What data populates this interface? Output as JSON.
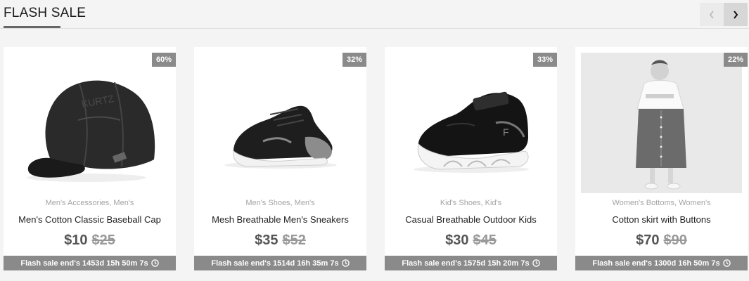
{
  "section": {
    "title": "FLASH SALE",
    "prev_icon": "chevron-left-icon",
    "next_icon": "chevron-right-icon"
  },
  "products": [
    {
      "discount": "60%",
      "category": "Men's Accessories, Men's",
      "name": "Men's Cotton Classic Baseball Cap",
      "price": "$10",
      "old_price": "$25",
      "countdown": "Flash sale end's 1453d 15h 50m 7s",
      "image": "baseball-cap"
    },
    {
      "discount": "32%",
      "category": "Men's Shoes, Men's",
      "name": "Mesh Breathable Men's Sneakers",
      "price": "$35",
      "old_price": "$52",
      "countdown": "Flash sale end's 1514d 16h 35m 7s",
      "image": "sneaker"
    },
    {
      "discount": "33%",
      "category": "Kid's Shoes, Kid's",
      "name": "Casual Breathable Outdoor Kids",
      "price": "$30",
      "old_price": "$45",
      "countdown": "Flash sale end's 1575d 15h 20m 7s",
      "image": "kids-shoe"
    },
    {
      "discount": "22%",
      "category": "Women's Bottoms, Women's",
      "name": "Cotton skirt with Buttons",
      "price": "$70",
      "old_price": "$90",
      "countdown": "Flash sale end's 1300d 16h 50m 7s",
      "image": "woman-in-skirt"
    }
  ],
  "colors": {
    "badge": "#8a8a8a",
    "countdown_bar": "#8a8a8a",
    "background": "#f4f4f4"
  }
}
